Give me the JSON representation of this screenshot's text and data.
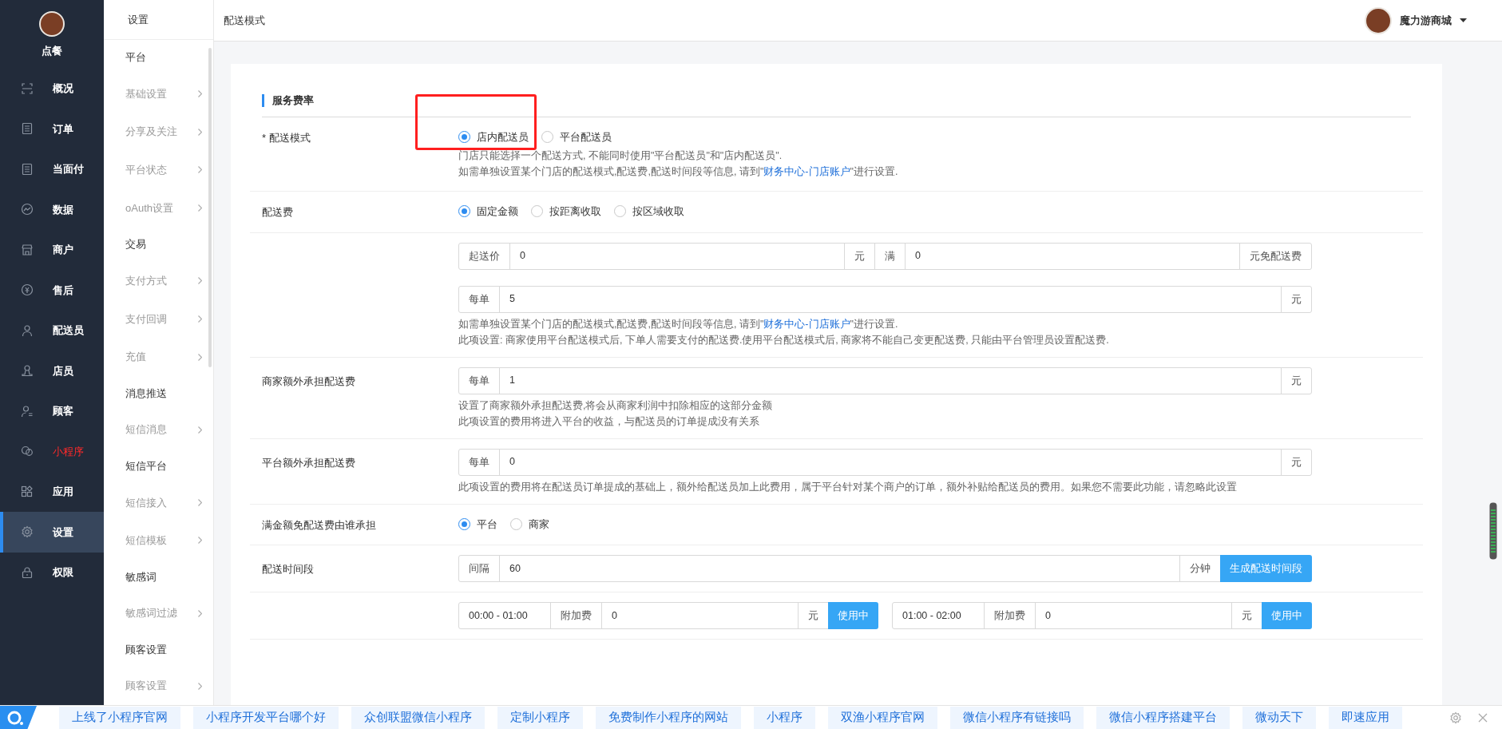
{
  "sidebar": {
    "brand": "点餐",
    "items": [
      {
        "label": "概况",
        "selected": false,
        "highlighted": false
      },
      {
        "label": "订单",
        "selected": false,
        "highlighted": false
      },
      {
        "label": "当面付",
        "selected": false,
        "highlighted": false
      },
      {
        "label": "数据",
        "selected": false,
        "highlighted": false
      },
      {
        "label": "商户",
        "selected": false,
        "highlighted": false
      },
      {
        "label": "售后",
        "selected": false,
        "highlighted": false
      },
      {
        "label": "配送员",
        "selected": false,
        "highlighted": false
      },
      {
        "label": "店员",
        "selected": false,
        "highlighted": false
      },
      {
        "label": "顾客",
        "selected": false,
        "highlighted": false
      },
      {
        "label": "小程序",
        "selected": false,
        "highlighted": true
      },
      {
        "label": "应用",
        "selected": false,
        "highlighted": false
      },
      {
        "label": "设置",
        "selected": true,
        "highlighted": false
      },
      {
        "label": "权限",
        "selected": false,
        "highlighted": false
      }
    ]
  },
  "subnav": {
    "title": "设置",
    "items": [
      {
        "label": "平台",
        "kind": "group"
      },
      {
        "label": "基础设置",
        "kind": "link"
      },
      {
        "label": "分享及关注",
        "kind": "link"
      },
      {
        "label": "平台状态",
        "kind": "link"
      },
      {
        "label": "oAuth设置",
        "kind": "link"
      },
      {
        "label": "交易",
        "kind": "group"
      },
      {
        "label": "支付方式",
        "kind": "link"
      },
      {
        "label": "支付回调",
        "kind": "link"
      },
      {
        "label": "充值",
        "kind": "link"
      },
      {
        "label": "消息推送",
        "kind": "group"
      },
      {
        "label": "短信消息",
        "kind": "link"
      },
      {
        "label": "短信平台",
        "kind": "group"
      },
      {
        "label": "短信接入",
        "kind": "link"
      },
      {
        "label": "短信模板",
        "kind": "link"
      },
      {
        "label": "敏感词",
        "kind": "group"
      },
      {
        "label": "敏感词过滤",
        "kind": "link"
      },
      {
        "label": "顾客设置",
        "kind": "group"
      },
      {
        "label": "顾客设置",
        "kind": "link"
      }
    ]
  },
  "header": {
    "title": "配送模式",
    "user": "魔力游商城"
  },
  "form": {
    "section_title": "服务费率",
    "rows": [
      {
        "kind": "radio",
        "label": "* 配送模式",
        "highlight_box": true,
        "options": [
          {
            "label": "店内配送员",
            "selected": true
          },
          {
            "label": "平台配送员",
            "selected": false
          }
        ],
        "notes": [
          [
            {
              "text": "门店只能选择一个配送方式, 不能同时使用\"平台配送员\"和\"店内配送员\".",
              "link": false
            }
          ],
          [
            {
              "text": "如需单独设置某个门店的配送模式,配送费,配送时间段等信息, 请到\"",
              "link": false
            },
            {
              "text": "财务中心-门店账户",
              "link": true
            },
            {
              "text": "\"进行设置.",
              "link": false
            }
          ]
        ]
      },
      {
        "kind": "radio",
        "label": "配送费",
        "options": [
          {
            "label": "固定金额",
            "selected": true
          },
          {
            "label": "按距离收取",
            "selected": false
          },
          {
            "label": "按区域收取",
            "selected": false
          }
        ]
      },
      {
        "kind": "fields",
        "lines": [
          [
            [
              {
                "kind": "addon",
                "text": "起送价"
              },
              {
                "kind": "input",
                "text": "0"
              },
              {
                "kind": "addon",
                "text": "元"
              },
              {
                "kind": "addon",
                "text": "满"
              },
              {
                "kind": "input",
                "text": "0"
              },
              {
                "kind": "addon",
                "text": "元免配送费"
              }
            ]
          ],
          [
            [
              {
                "kind": "addon",
                "text": "每单"
              },
              {
                "kind": "input",
                "text": "5"
              },
              {
                "kind": "addon",
                "text": "元"
              }
            ]
          ]
        ],
        "notes": [
          [
            {
              "text": "如需单独设置某个门店的配送模式,配送费,配送时间段等信息, 请到\"",
              "link": false
            },
            {
              "text": "财务中心-门店账户",
              "link": true
            },
            {
              "text": "\"进行设置.",
              "link": false
            }
          ],
          [
            {
              "text": "此项设置: 商家使用平台配送模式后, 下单人需要支付的配送费.使用平台配送模式后, 商家将不能自己变更配送费, 只能由平台管理员设置配送费.",
              "link": false
            }
          ]
        ]
      },
      {
        "kind": "fields",
        "label": "商家额外承担配送费",
        "lines": [
          [
            [
              {
                "kind": "addon",
                "text": "每单"
              },
              {
                "kind": "input",
                "text": "1"
              },
              {
                "kind": "addon",
                "text": "元"
              }
            ]
          ]
        ],
        "notes": [
          [
            {
              "text": "设置了商家额外承担配送费,将会从商家利润中扣除相应的这部分金额",
              "link": false
            }
          ],
          [
            {
              "text": "此项设置的费用将进入平台的收益，与配送员的订单提成没有关系",
              "link": false
            }
          ]
        ]
      },
      {
        "kind": "fields",
        "label": "平台额外承担配送费",
        "lines": [
          [
            [
              {
                "kind": "addon",
                "text": "每单"
              },
              {
                "kind": "input",
                "text": "0"
              },
              {
                "kind": "addon",
                "text": "元"
              }
            ]
          ]
        ],
        "notes": [
          [
            {
              "text": "此项设置的费用将在配送员订单提成的基础上，额外给配送员加上此费用，属于平台针对某个商户的订单，额外补贴给配送员的费用。如果您不需要此功能，请忽略此设置",
              "link": false
            }
          ]
        ]
      },
      {
        "kind": "radio",
        "label": "满金额免配送费由谁承担",
        "options": [
          {
            "label": "平台",
            "selected": true
          },
          {
            "label": "商家",
            "selected": false
          }
        ]
      },
      {
        "kind": "fields",
        "label": "配送时间段",
        "lines": [
          [
            [
              {
                "kind": "addon",
                "text": "间隔"
              },
              {
                "kind": "input",
                "text": "60"
              },
              {
                "kind": "addon",
                "text": "分钟"
              },
              {
                "kind": "button",
                "text": "生成配送时间段"
              }
            ]
          ]
        ]
      },
      {
        "kind": "fields",
        "lines": [
          [
            [
              {
                "kind": "range",
                "text": "00:00 - 01:00"
              },
              {
                "kind": "addon",
                "text": "附加费"
              },
              {
                "kind": "input",
                "text": "0"
              },
              {
                "kind": "addon",
                "text": "元"
              },
              {
                "kind": "button",
                "text": "使用中"
              }
            ],
            [
              {
                "kind": "range",
                "text": "01:00 - 02:00"
              },
              {
                "kind": "addon",
                "text": "附加费"
              },
              {
                "kind": "input",
                "text": "0"
              },
              {
                "kind": "addon",
                "text": "元"
              },
              {
                "kind": "button",
                "text": "使用中"
              }
            ]
          ]
        ]
      }
    ]
  },
  "ad_bar": {
    "links": [
      "上线了小程序官网",
      "小程序开发平台哪个好",
      "众创联盟微信小程序",
      "定制小程序",
      "免费制作小程序的网站",
      "小程序",
      "双渔小程序官网",
      "微信小程序有链接吗",
      "微信小程序搭建平台",
      "微动天下",
      "即速应用"
    ]
  }
}
